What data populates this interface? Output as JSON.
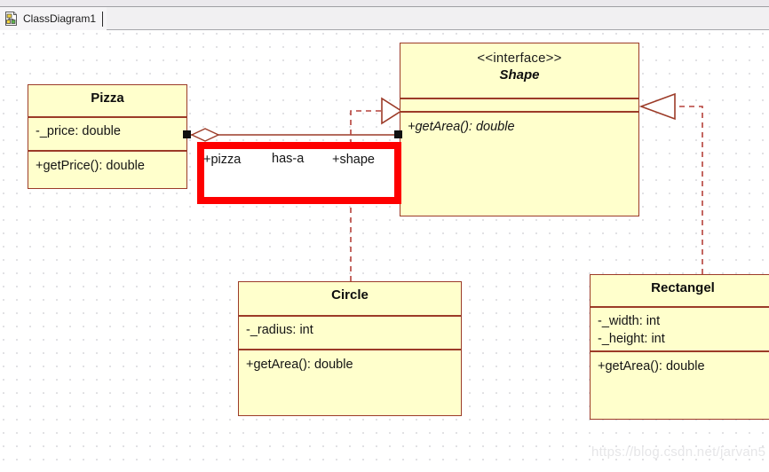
{
  "window": {
    "tab": {
      "label": "ClassDiagram1",
      "icon": "class-diagram-icon"
    }
  },
  "colors": {
    "node_fill": "#FFFFCC",
    "node_border": "#9C3B28",
    "highlight": "#FE0000",
    "anchor": "#101010",
    "grid_dot": "#D9D9DD",
    "canvas": "#FFFFFF",
    "watermark": "#E6E6E8"
  },
  "diagram": {
    "nodes": [
      {
        "id": "pizza",
        "stereotype": "",
        "name": "Pizza",
        "attributes": [
          "-_price: double"
        ],
        "operations": [
          "+getPrice(): double"
        ]
      },
      {
        "id": "shape",
        "stereotype": "<<interface>>",
        "name": "Shape",
        "attributes": [],
        "operations": [
          "+getArea(): double"
        ]
      },
      {
        "id": "circle",
        "stereotype": "",
        "name": "Circle",
        "attributes": [
          "-_radius: int"
        ],
        "operations": [
          "+getArea(): double"
        ]
      },
      {
        "id": "rectangel",
        "stereotype": "",
        "name": "Rectangel",
        "attributes": [
          "-_width: int",
          "-_height: int"
        ],
        "operations": [
          "+getArea(): double"
        ]
      }
    ],
    "association": {
      "source_role": "+pizza",
      "name": "has-a",
      "target_role": "+shape",
      "kind": "aggregation"
    },
    "realizations": [
      {
        "from": "Circle",
        "to": "Shape",
        "kind": "realization"
      },
      {
        "from": "Rectangel",
        "to": "Shape",
        "kind": "realization"
      }
    ]
  },
  "watermark": {
    "text": "https://blog.csdn.net/jarvan5"
  }
}
